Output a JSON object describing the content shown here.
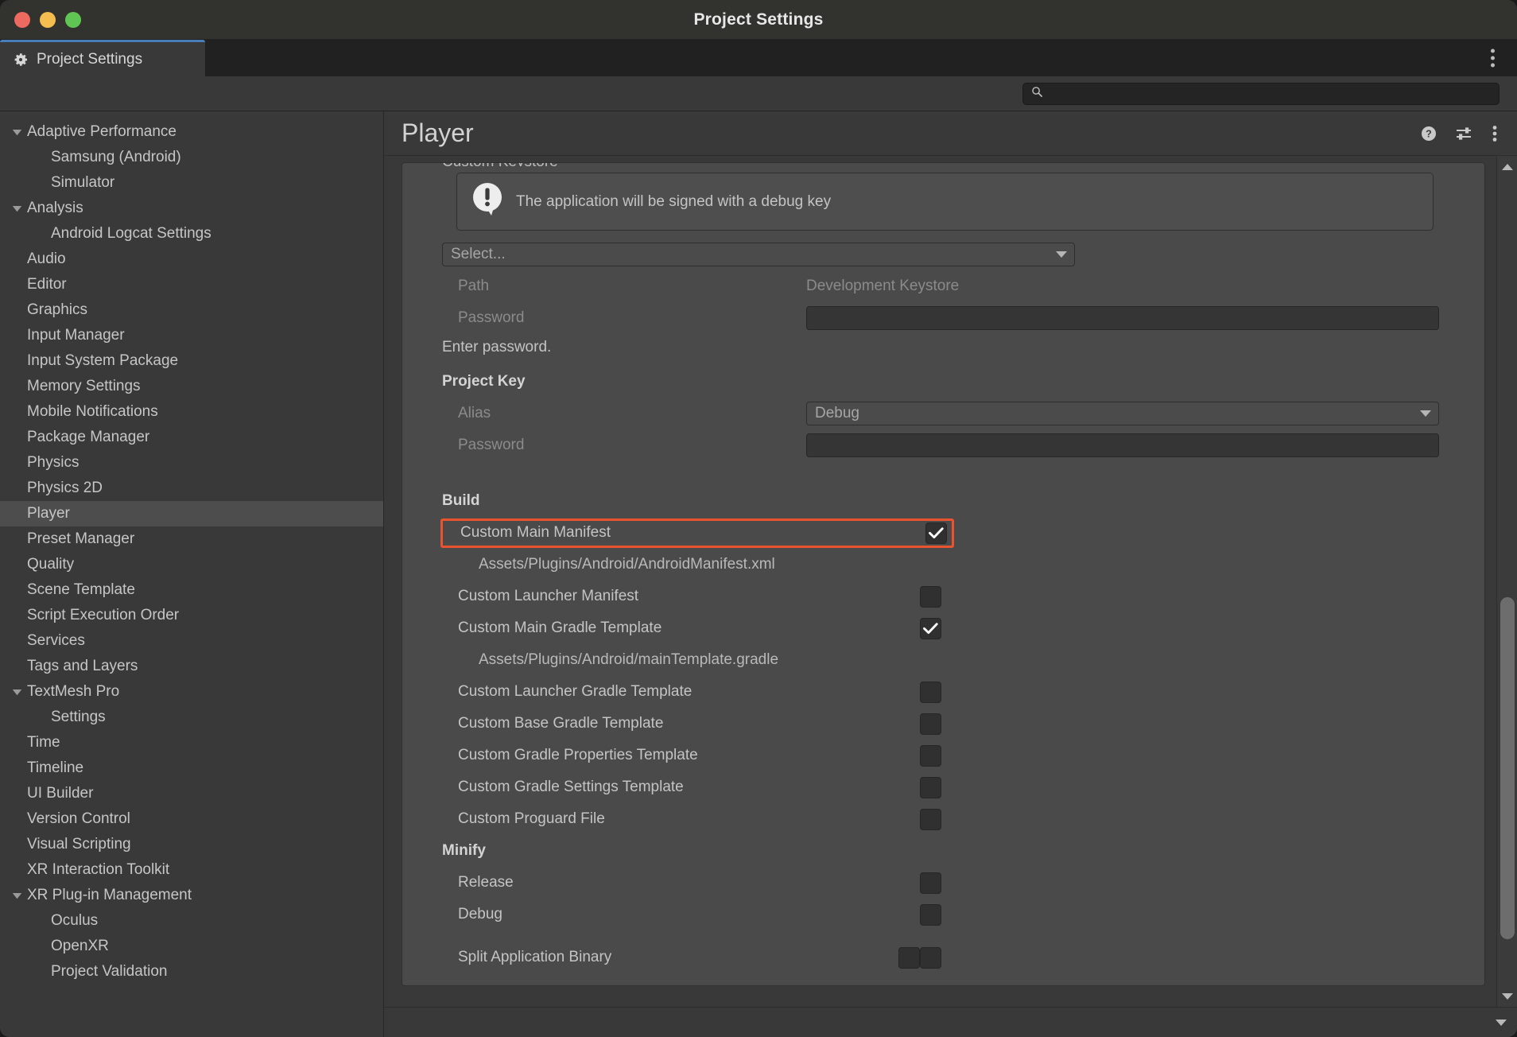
{
  "window": {
    "title": "Project Settings",
    "traffic_lights": [
      "close-red",
      "minimize-yellow",
      "maximize-green"
    ]
  },
  "tab": {
    "label": "Project Settings",
    "icon": "gear-icon",
    "accent_color": "#4a7ebb"
  },
  "tabstrip": {
    "overflow_menu_icon": "vertical-dots-icon"
  },
  "search": {
    "value": "",
    "placeholder": "",
    "icon": "search-icon"
  },
  "sidebar": {
    "items": [
      {
        "label": "Adaptive Performance",
        "level": 0,
        "expandable": true,
        "expanded": true,
        "selected": false
      },
      {
        "label": "Samsung (Android)",
        "level": 1,
        "expandable": false,
        "expanded": false,
        "selected": false
      },
      {
        "label": "Simulator",
        "level": 1,
        "expandable": false,
        "expanded": false,
        "selected": false
      },
      {
        "label": "Analysis",
        "level": 0,
        "expandable": true,
        "expanded": true,
        "selected": false
      },
      {
        "label": "Android Logcat Settings",
        "level": 1,
        "expandable": false,
        "expanded": false,
        "selected": false
      },
      {
        "label": "Audio",
        "level": 0,
        "expandable": false,
        "expanded": false,
        "selected": false
      },
      {
        "label": "Editor",
        "level": 0,
        "expandable": false,
        "expanded": false,
        "selected": false
      },
      {
        "label": "Graphics",
        "level": 0,
        "expandable": false,
        "expanded": false,
        "selected": false
      },
      {
        "label": "Input Manager",
        "level": 0,
        "expandable": false,
        "expanded": false,
        "selected": false
      },
      {
        "label": "Input System Package",
        "level": 0,
        "expandable": false,
        "expanded": false,
        "selected": false
      },
      {
        "label": "Memory Settings",
        "level": 0,
        "expandable": false,
        "expanded": false,
        "selected": false
      },
      {
        "label": "Mobile Notifications",
        "level": 0,
        "expandable": false,
        "expanded": false,
        "selected": false
      },
      {
        "label": "Package Manager",
        "level": 0,
        "expandable": false,
        "expanded": false,
        "selected": false
      },
      {
        "label": "Physics",
        "level": 0,
        "expandable": false,
        "expanded": false,
        "selected": false
      },
      {
        "label": "Physics 2D",
        "level": 0,
        "expandable": false,
        "expanded": false,
        "selected": false
      },
      {
        "label": "Player",
        "level": 0,
        "expandable": false,
        "expanded": false,
        "selected": true
      },
      {
        "label": "Preset Manager",
        "level": 0,
        "expandable": false,
        "expanded": false,
        "selected": false
      },
      {
        "label": "Quality",
        "level": 0,
        "expandable": false,
        "expanded": false,
        "selected": false
      },
      {
        "label": "Scene Template",
        "level": 0,
        "expandable": false,
        "expanded": false,
        "selected": false
      },
      {
        "label": "Script Execution Order",
        "level": 0,
        "expandable": false,
        "expanded": false,
        "selected": false
      },
      {
        "label": "Services",
        "level": 0,
        "expandable": false,
        "expanded": false,
        "selected": false
      },
      {
        "label": "Tags and Layers",
        "level": 0,
        "expandable": false,
        "expanded": false,
        "selected": false
      },
      {
        "label": "TextMesh Pro",
        "level": 0,
        "expandable": true,
        "expanded": true,
        "selected": false
      },
      {
        "label": "Settings",
        "level": 1,
        "expandable": false,
        "expanded": false,
        "selected": false
      },
      {
        "label": "Time",
        "level": 0,
        "expandable": false,
        "expanded": false,
        "selected": false
      },
      {
        "label": "Timeline",
        "level": 0,
        "expandable": false,
        "expanded": false,
        "selected": false
      },
      {
        "label": "UI Builder",
        "level": 0,
        "expandable": false,
        "expanded": false,
        "selected": false
      },
      {
        "label": "Version Control",
        "level": 0,
        "expandable": false,
        "expanded": false,
        "selected": false
      },
      {
        "label": "Visual Scripting",
        "level": 0,
        "expandable": false,
        "expanded": false,
        "selected": false
      },
      {
        "label": "XR Interaction Toolkit",
        "level": 0,
        "expandable": false,
        "expanded": false,
        "selected": false
      },
      {
        "label": "XR Plug-in Management",
        "level": 0,
        "expandable": true,
        "expanded": true,
        "selected": false
      },
      {
        "label": "Oculus",
        "level": 1,
        "expandable": false,
        "expanded": false,
        "selected": false
      },
      {
        "label": "OpenXR",
        "level": 1,
        "expandable": false,
        "expanded": false,
        "selected": false
      },
      {
        "label": "Project Validation",
        "level": 1,
        "expandable": false,
        "expanded": false,
        "selected": false
      }
    ]
  },
  "main": {
    "title": "Player",
    "header_icons": [
      "help-icon",
      "settings-sliders-icon",
      "vertical-dots-icon"
    ],
    "warning": {
      "icon": "warning-exclamation-icon",
      "text": "The application will be signed with a debug key"
    },
    "keystore": {
      "select_label": "Select...",
      "path_label": "Path",
      "path_value": "Development Keystore",
      "password_label": "Password",
      "password_value": "",
      "hint": "Enter password."
    },
    "project_key": {
      "section_label": "Project Key",
      "alias_label": "Alias",
      "alias_value": "Debug",
      "password_label": "Password",
      "password_value": ""
    },
    "build": {
      "section_label": "Build",
      "options": [
        {
          "label": "Custom Main Manifest",
          "checked": true,
          "highlighted": true,
          "path": "Assets/Plugins/Android/AndroidManifest.xml"
        },
        {
          "label": "Custom Launcher Manifest",
          "checked": false,
          "highlighted": false,
          "path": ""
        },
        {
          "label": "Custom Main Gradle Template",
          "checked": true,
          "highlighted": false,
          "path": "Assets/Plugins/Android/mainTemplate.gradle"
        },
        {
          "label": "Custom Launcher Gradle Template",
          "checked": false,
          "highlighted": false,
          "path": ""
        },
        {
          "label": "Custom Base Gradle Template",
          "checked": false,
          "highlighted": false,
          "path": ""
        },
        {
          "label": "Custom Gradle Properties Template",
          "checked": false,
          "highlighted": false,
          "path": ""
        },
        {
          "label": "Custom Gradle Settings Template",
          "checked": false,
          "highlighted": false,
          "path": ""
        },
        {
          "label": "Custom Proguard File",
          "checked": false,
          "highlighted": false,
          "path": ""
        }
      ]
    },
    "minify": {
      "section_label": "Minify",
      "options": [
        {
          "label": "Release",
          "checked": false
        },
        {
          "label": "Debug",
          "checked": false
        }
      ]
    },
    "split_binary": {
      "label": "Split Application Binary",
      "checked": false
    }
  },
  "colors": {
    "highlight_border": "#e9542f",
    "tab_accent": "#4a7ebb",
    "panel_bg": "#4a4a4a",
    "window_bg": "#393939"
  }
}
